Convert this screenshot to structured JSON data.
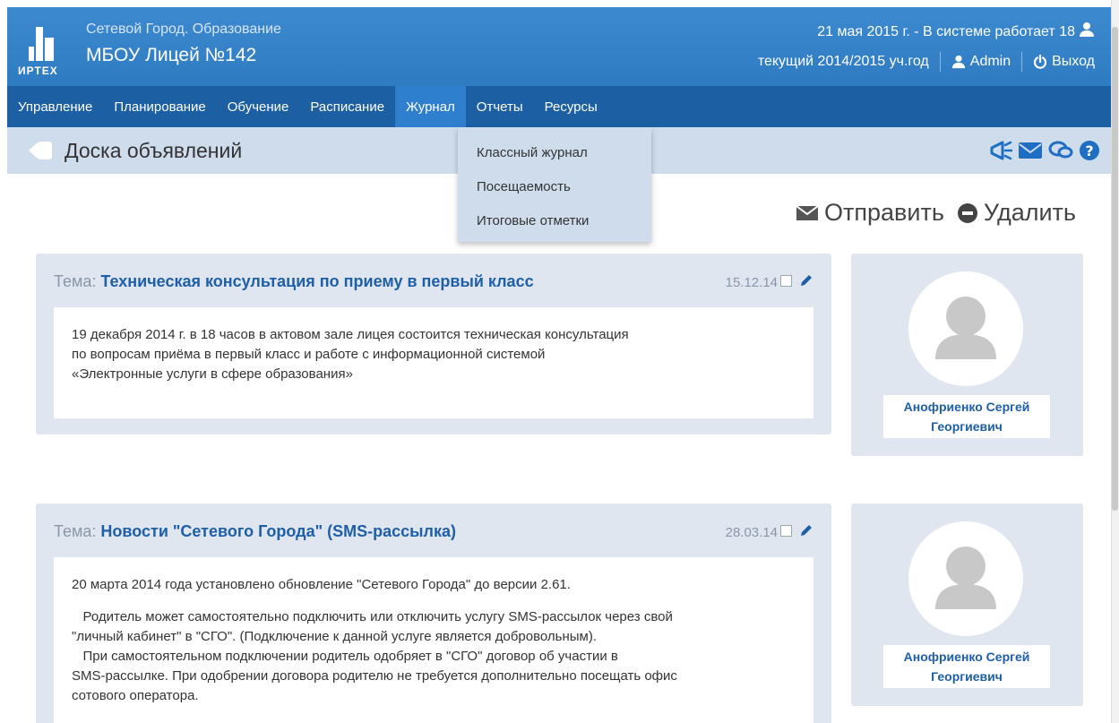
{
  "header": {
    "logo_text": "ИРТЕХ",
    "org_subtitle": "Сетевой Город. Образование",
    "org_name": "МБОУ Лицей №142",
    "status_text": "21 мая 2015 г. - В системе работает 18",
    "year_text": "текущий 2014/2015 уч.год",
    "user_label": "Admin",
    "logout_label": "Выход"
  },
  "nav": {
    "items": [
      "Управление",
      "Планирование",
      "Обучение",
      "Расписание",
      "Журнал",
      "Отчеты",
      "Ресурсы"
    ],
    "active": "Журнал"
  },
  "dropdown": {
    "items": [
      "Классный журнал",
      "Посещаемость",
      "Итоговые отметки"
    ]
  },
  "page": {
    "title": "Доска объявлений"
  },
  "actions": {
    "send_label": "Отправить",
    "delete_label": "Удалить"
  },
  "posts": [
    {
      "theme_label": "Тема:",
      "title": "Техническая консультация по приему в первый класс",
      "date": "15.12.14",
      "body": [
        "19 декабря 2014 г. в 18 часов в актовом зале лицея состоится техническая консультация",
        "по вопросам приёма в первый класс и работе с информационной системой",
        "«Электронные услуги в сфере образования»"
      ],
      "author": "Анофриенко Сергей Георгиевич"
    },
    {
      "theme_label": "Тема:",
      "title": "Новости \"Сетевого Города\" (SMS-рассылка)",
      "date": "28.03.14",
      "body": [
        "20 марта 2014 года установлено обновление \"Сетевого Города\" до версии 2.61.",
        "",
        "   Родитель может самостоятельно подключить или отключить услугу SMS-рассылок через свой",
        "\"личный кабинет\" в \"СГО\". (Подключение к данной услуге является добровольным).",
        "   При самостоятельном подключении родитель одобряет в \"СГО\" договор об участии в",
        "SMS-рассылке. При одобрении договора родителю не требуется дополнительно посещать офис",
        "сотового оператора."
      ],
      "author": "Анофриенко Сергей Георгиевич"
    }
  ],
  "colors": {
    "header": "#3d8ad0",
    "nav": "#1c5fa3",
    "nav_active": "#2f7fcf",
    "titlebar": "#cfdcec",
    "link": "#1e5fa6"
  }
}
